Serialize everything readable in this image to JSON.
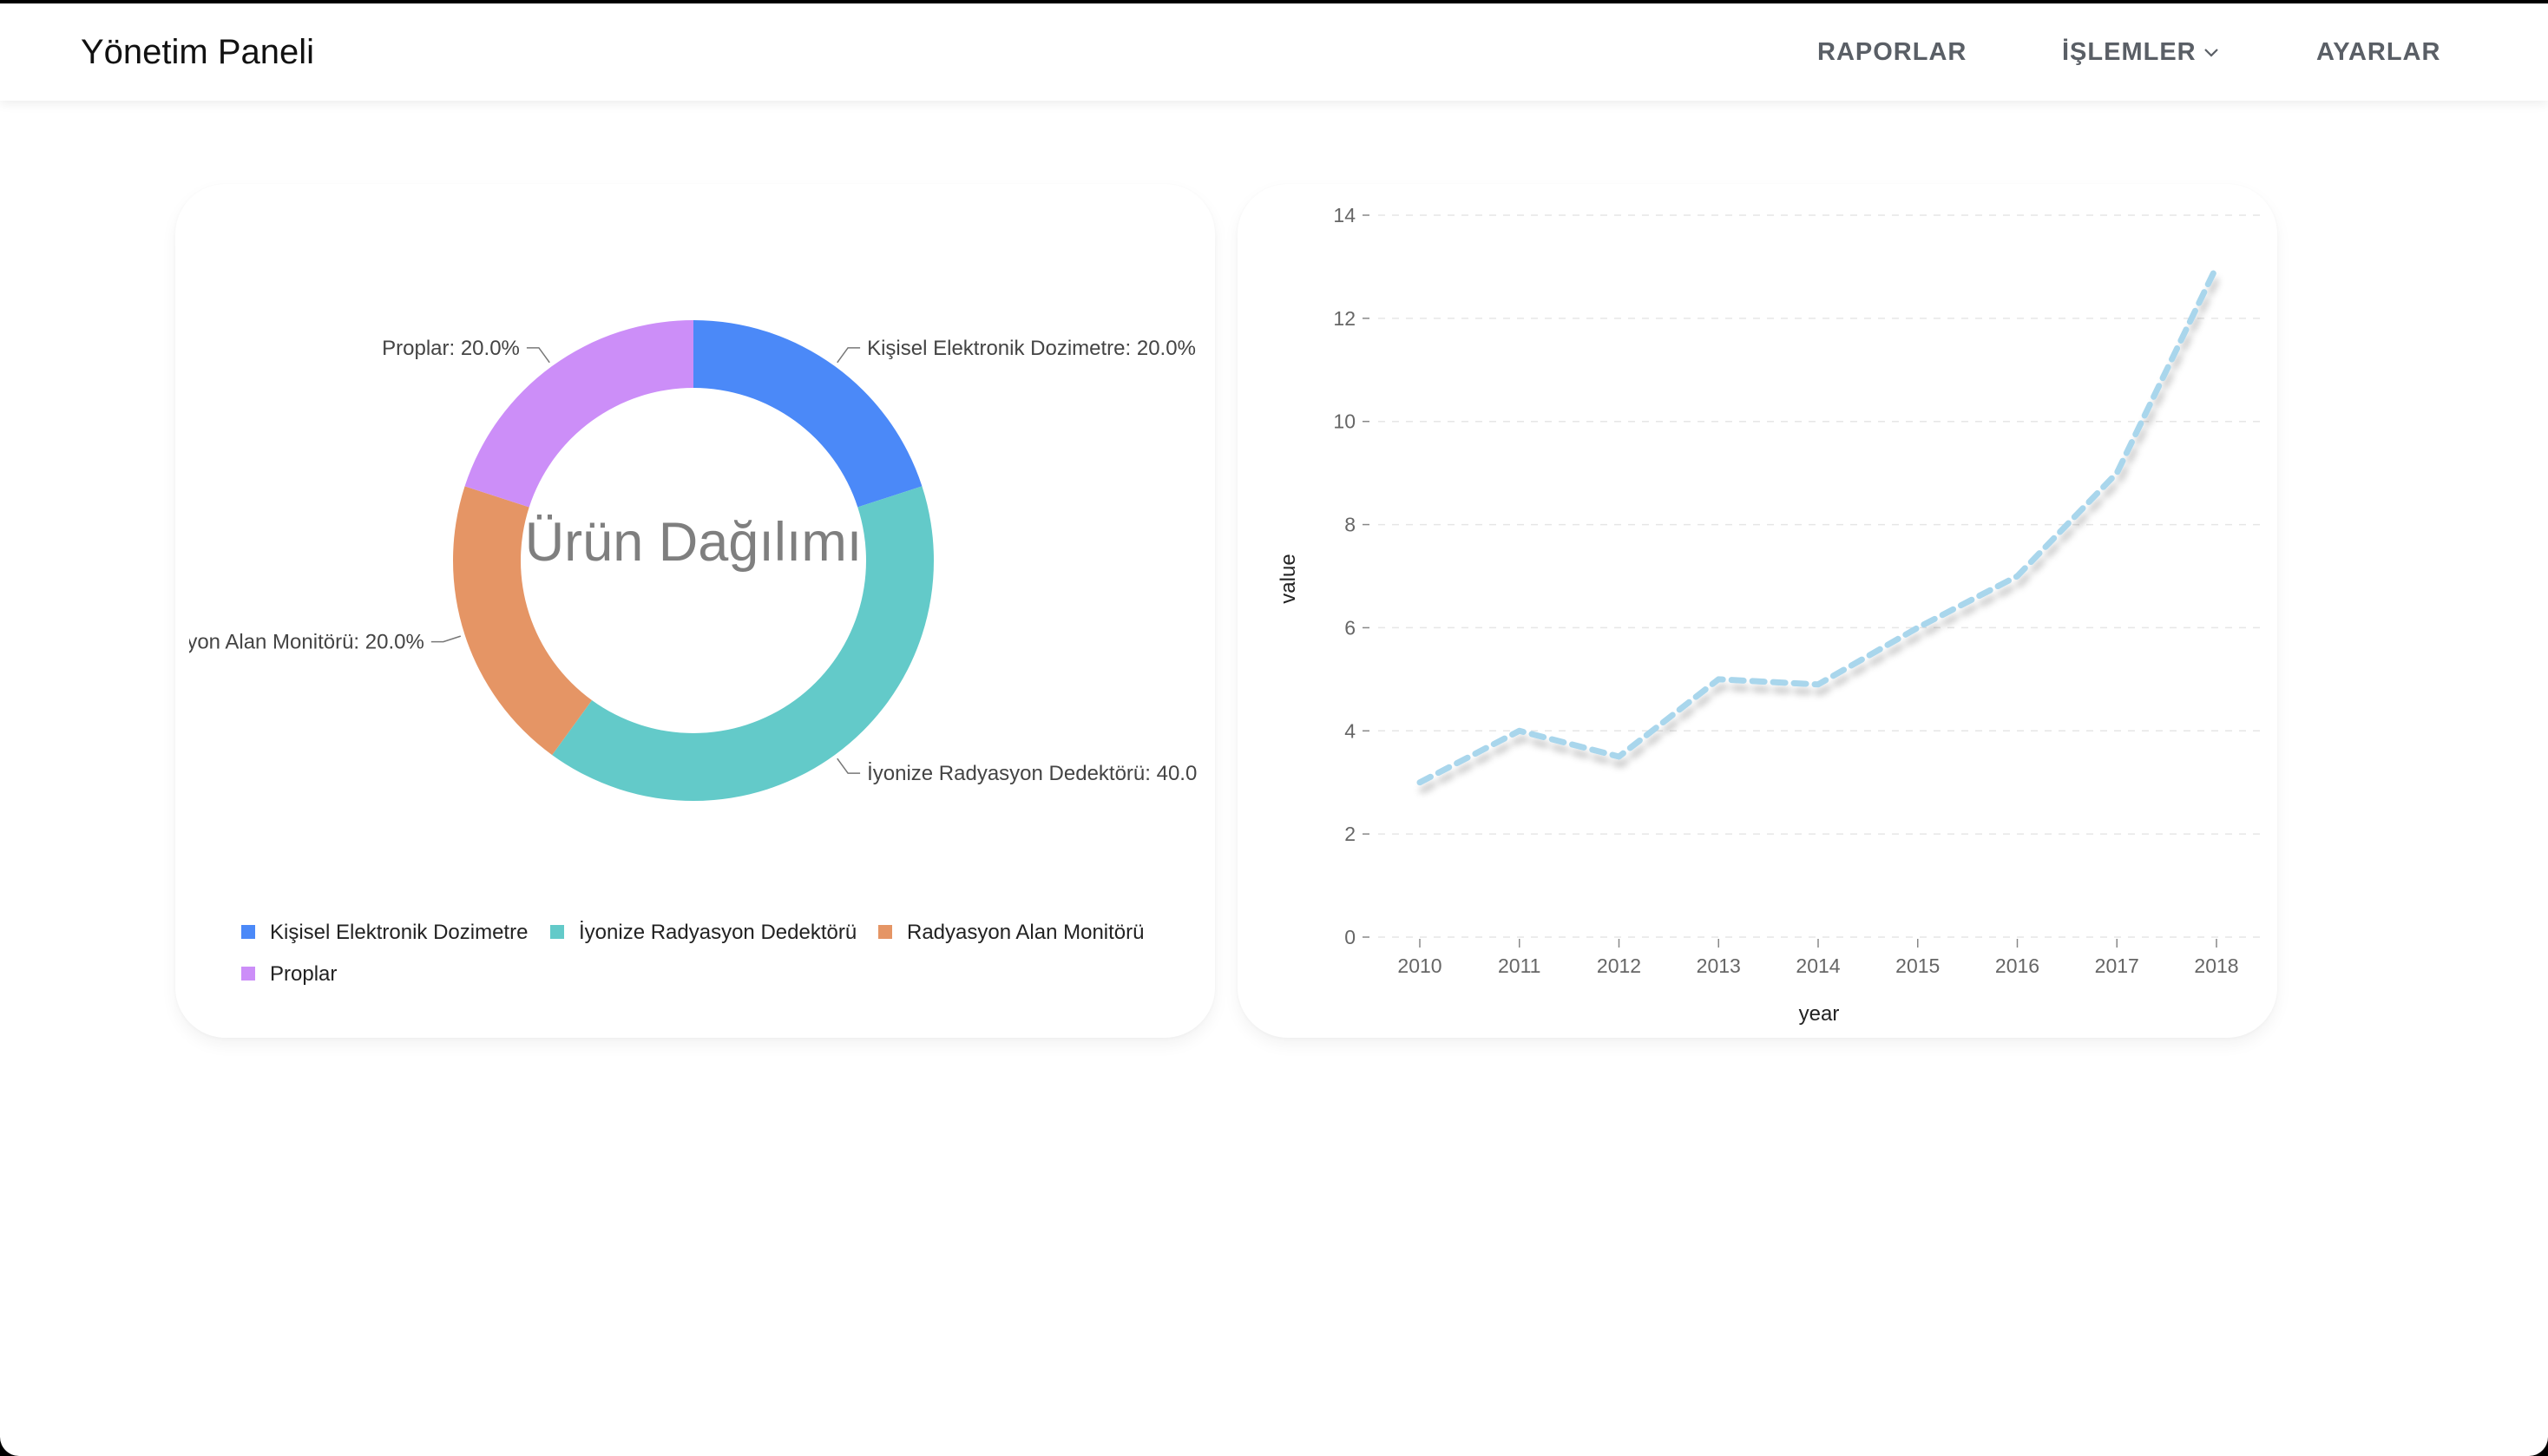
{
  "navbar": {
    "brand": "Yönetim Paneli",
    "links": {
      "reports": "RAPORLAR",
      "operations": "İŞLEMLER",
      "settings": "AYARLAR"
    }
  },
  "colors": {
    "series": [
      "#4b89f8",
      "#63cac9",
      "#e59565",
      "#cc8ef8"
    ],
    "line": "#a9d6ec"
  },
  "chart_data": [
    {
      "type": "pie",
      "donut": true,
      "center_text": "Ürün Dağılımı",
      "categories": [
        "Kişisel Elektronik Dozimetre",
        "İyonize Radyasyon Dedektörü",
        "Radyasyon Alan Monitörü",
        "Proplar"
      ],
      "values": [
        20.0,
        40.0,
        20.0,
        20.0
      ],
      "slice_labels": [
        "Kişisel Elektronik Dozimetre: 20.0%",
        "İyonize Radyasyon Dedektörü: 40.0",
        "yon Alan Monitörü: 20.0%",
        "Proplar: 20.0%"
      ],
      "legend": {
        "position": "bottom",
        "entries": [
          "Kişisel Elektronik Dozimetre",
          "İyonize Radyasyon Dedektörü",
          "Radyasyon Alan Monitörü",
          "Proplar"
        ]
      }
    },
    {
      "type": "line",
      "style": "dashed",
      "xlabel": "year",
      "ylabel": "value",
      "x": [
        "2010",
        "2011",
        "2012",
        "2013",
        "2014",
        "2015",
        "2016",
        "2017",
        "2018"
      ],
      "series": [
        {
          "values": [
            3,
            4,
            3.5,
            5,
            4.9,
            6,
            7,
            9,
            13
          ]
        }
      ],
      "ylim": [
        0,
        14
      ],
      "yticks": [
        "0",
        "2",
        "4",
        "6",
        "8",
        "10",
        "12",
        "14"
      ],
      "grid": true
    }
  ]
}
